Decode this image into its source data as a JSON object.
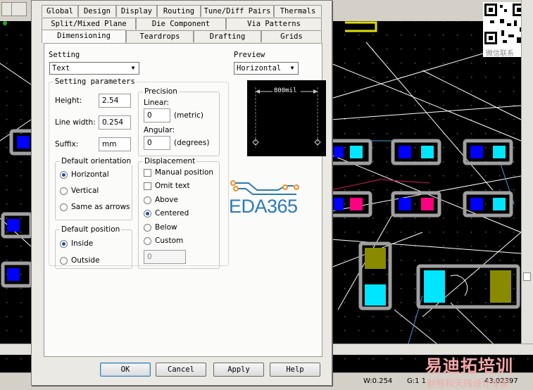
{
  "tabs_row1": [
    "Global",
    "Design",
    "Display",
    "Routing",
    "Tune/Diff Pairs",
    "Thermals"
  ],
  "tabs_row2": [
    "Split/Mixed Plane",
    "Die Component",
    "Via Patterns"
  ],
  "tabs_row3": [
    "Dimensioning",
    "Teardrops",
    "Drafting",
    "Grids"
  ],
  "active_tab": "Dimensioning",
  "setting": {
    "label": "Setting",
    "value": "Text"
  },
  "preview": {
    "label": "Preview",
    "value": "Horizontal",
    "dimension_text": "800mil"
  },
  "setting_parameters": {
    "title": "Setting parameters",
    "height_label": "Height:",
    "height_value": "2.54",
    "line_width_label": "Line width:",
    "line_width_value": "0.254",
    "suffix_label": "Suffix:",
    "suffix_value": "mm"
  },
  "precision": {
    "title": "Precision",
    "linear_label": "Linear:",
    "linear_value": "0",
    "linear_unit": "(metric)",
    "angular_label": "Angular:",
    "angular_value": "0",
    "angular_unit": "(degrees)"
  },
  "default_orientation": {
    "title": "Default orientation",
    "options": [
      "Horizontal",
      "Vertical",
      "Same as arrows"
    ],
    "selected": "Horizontal"
  },
  "default_position": {
    "title": "Default position",
    "options": [
      "Inside",
      "Outside"
    ],
    "selected": "Inside"
  },
  "displacement": {
    "title": "Displacement",
    "manual_position": "Manual position",
    "omit_text": "Omit text",
    "options": [
      "Above",
      "Centered",
      "Below",
      "Custom"
    ],
    "selected": "Centered",
    "custom_value": "0"
  },
  "buttons": {
    "ok": "OK",
    "cancel": "Cancel",
    "apply": "Apply",
    "help": "Help"
  },
  "logo_text": "EDA365",
  "status": {
    "w": "W:0.254",
    "g": "G:1 1",
    "coord": "43.02397"
  },
  "watermark": {
    "line1": "易迪拓培训",
    "line2": "射频和天线设计专家"
  },
  "qr_caption": "微信联系",
  "colors": {
    "accent": "#1a4fa0",
    "logo_blue": "#2a7ab8",
    "logo_orange": "#e8902a",
    "pad_blue": "#0000ff",
    "pad_cyan": "#00e6ff",
    "pad_magenta": "#ff0080",
    "pad_olive": "#8a8a00",
    "trace": "#ffffff",
    "board_outline": "#a0a0a0"
  }
}
